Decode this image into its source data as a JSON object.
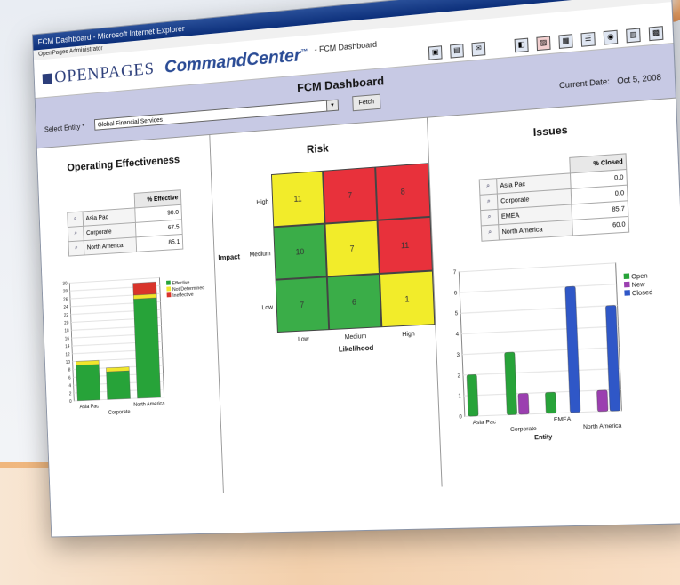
{
  "window": {
    "title": "FCM Dashboard - Microsoft Internet Explorer",
    "controls": [
      "_",
      "□",
      "×"
    ]
  },
  "user_bar": "OpenPages Administrator",
  "brand": {
    "logo": "OPENPAGES",
    "product": "CommandCenter",
    "tm": "™",
    "crumb": "- FCM Dashboard"
  },
  "toolbar_icons": [
    "save-icon",
    "print-icon",
    "email-icon",
    "export-icon",
    "pdf-icon",
    "grid-icon",
    "list-icon",
    "chart-icon",
    "report-icon",
    "calendar-icon"
  ],
  "header": {
    "title": "FCM Dashboard",
    "select_label": "Select Entity *",
    "select_value": "Global Financial Services",
    "fetch_label": "Fetch",
    "date_label": "Current Date:",
    "date_value": "Oct 5, 2008"
  },
  "effectiveness": {
    "title": "Operating Effectiveness",
    "table_header": "% Effective",
    "rows": [
      {
        "name": "Asia Pac",
        "value": "90.0"
      },
      {
        "name": "Corporate",
        "value": "67.5"
      },
      {
        "name": "North America",
        "value": "85.1"
      }
    ]
  },
  "risk": {
    "title": "Risk",
    "ylabel": "Impact",
    "xlabel": "Likelihood",
    "rows": [
      "High",
      "Medium",
      "Low"
    ],
    "cols": [
      "Low",
      "Medium",
      "High"
    ],
    "cells": [
      [
        {
          "v": "11",
          "c": "#f2ec2a"
        },
        {
          "v": "7",
          "c": "#e8313b"
        },
        {
          "v": "8",
          "c": "#e8313b"
        }
      ],
      [
        {
          "v": "10",
          "c": "#3aad48"
        },
        {
          "v": "7",
          "c": "#f2ec2a"
        },
        {
          "v": "11",
          "c": "#e8313b"
        }
      ],
      [
        {
          "v": "7",
          "c": "#3aad48"
        },
        {
          "v": "6",
          "c": "#3aad48"
        },
        {
          "v": "1",
          "c": "#f2ec2a"
        }
      ]
    ]
  },
  "issues": {
    "title": "Issues",
    "table_header": "% Closed",
    "rows": [
      {
        "name": "Asia Pac",
        "value": "0.0"
      },
      {
        "name": "Corporate",
        "value": "0.0"
      },
      {
        "name": "EMEA",
        "value": "85.7"
      },
      {
        "name": "North America",
        "value": "60.0"
      }
    ]
  },
  "chart_data": [
    {
      "type": "bar",
      "stacked": true,
      "categories": [
        "Asia Pac",
        "Corporate",
        "North America"
      ],
      "series": [
        {
          "name": "Effective",
          "color": "#27a339",
          "values": [
            9,
            7,
            25
          ]
        },
        {
          "name": "Not Determined",
          "color": "#f0e62c",
          "values": [
            1,
            1,
            1
          ]
        },
        {
          "name": "Ineffective",
          "color": "#d9342b",
          "values": [
            0,
            0,
            3
          ]
        }
      ],
      "ylim": [
        0,
        30
      ],
      "yticks": [
        "0",
        "2",
        "4",
        "6",
        "8",
        "10",
        "12",
        "14",
        "16",
        "18",
        "20",
        "22",
        "24",
        "26",
        "28",
        "30"
      ],
      "xlabel": "Corporate"
    },
    {
      "type": "bar",
      "categories": [
        "Asia Pac",
        "Corporate",
        "EMEA",
        "North America"
      ],
      "series": [
        {
          "name": "Open",
          "color": "#27a339",
          "values": [
            2,
            3,
            1,
            0
          ]
        },
        {
          "name": "New",
          "color": "#9b3fb0",
          "values": [
            0,
            1,
            0,
            1
          ]
        },
        {
          "name": "Closed",
          "color": "#2f57c7",
          "values": [
            0,
            0,
            6,
            5
          ]
        }
      ],
      "ylim": [
        0,
        7
      ],
      "yticks": [
        "0",
        "1",
        "2",
        "3",
        "4",
        "5",
        "6",
        "7"
      ],
      "xlabel": "Entity"
    }
  ]
}
